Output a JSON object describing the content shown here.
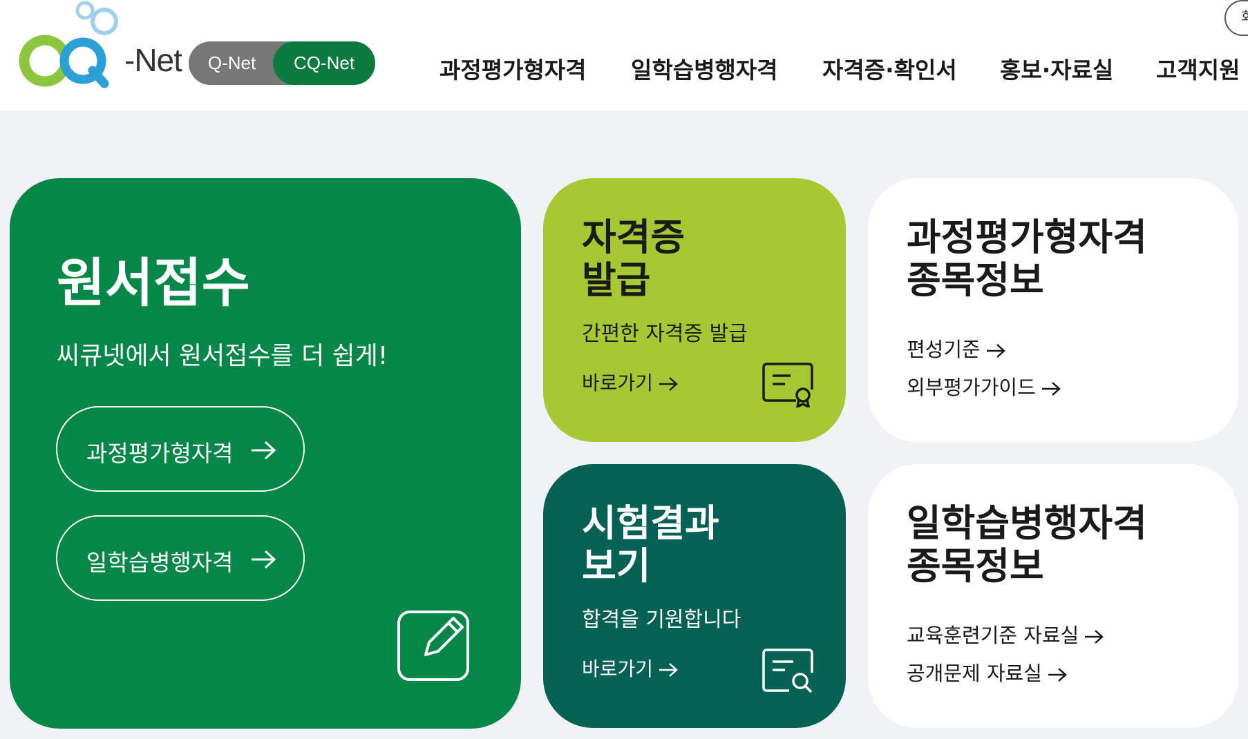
{
  "header": {
    "logo_text": "-Net",
    "switch": {
      "option_q": "Q-Net",
      "option_cq": "CQ-Net"
    },
    "nav": [
      "과정평가형자격",
      "일학습병행자격",
      "자격증·확인서",
      "홍보·자료실",
      "고객지원"
    ],
    "side_button": "회"
  },
  "main_card": {
    "title": "원서접수",
    "subtitle": "씨큐넷에서 원서접수를 더 쉽게!",
    "buttons": [
      "과정평가형자격",
      "일학습병행자격"
    ]
  },
  "cert_card": {
    "title_line1": "자격증",
    "title_line2": "발급",
    "subtitle": "간편한 자격증 발급",
    "link": "바로가기"
  },
  "result_card": {
    "title_line1": "시험결과",
    "title_line2": "보기",
    "subtitle": "합격을 기원합니다",
    "link": "바로가기"
  },
  "course_card": {
    "title_line1": "과정평가형자격",
    "title_line2": "종목정보",
    "links": [
      "편성기준",
      "외부평가가이드"
    ]
  },
  "worklearn_card": {
    "title_line1": "일학습병행자격",
    "title_line2": "종목정보",
    "links": [
      "교육훈련기준 자료실",
      "공개문제 자료실"
    ]
  },
  "colors": {
    "brand_green": "#058747",
    "lime": "#a6c832",
    "teal": "#046154",
    "page_bg": "#f1f2f5"
  }
}
